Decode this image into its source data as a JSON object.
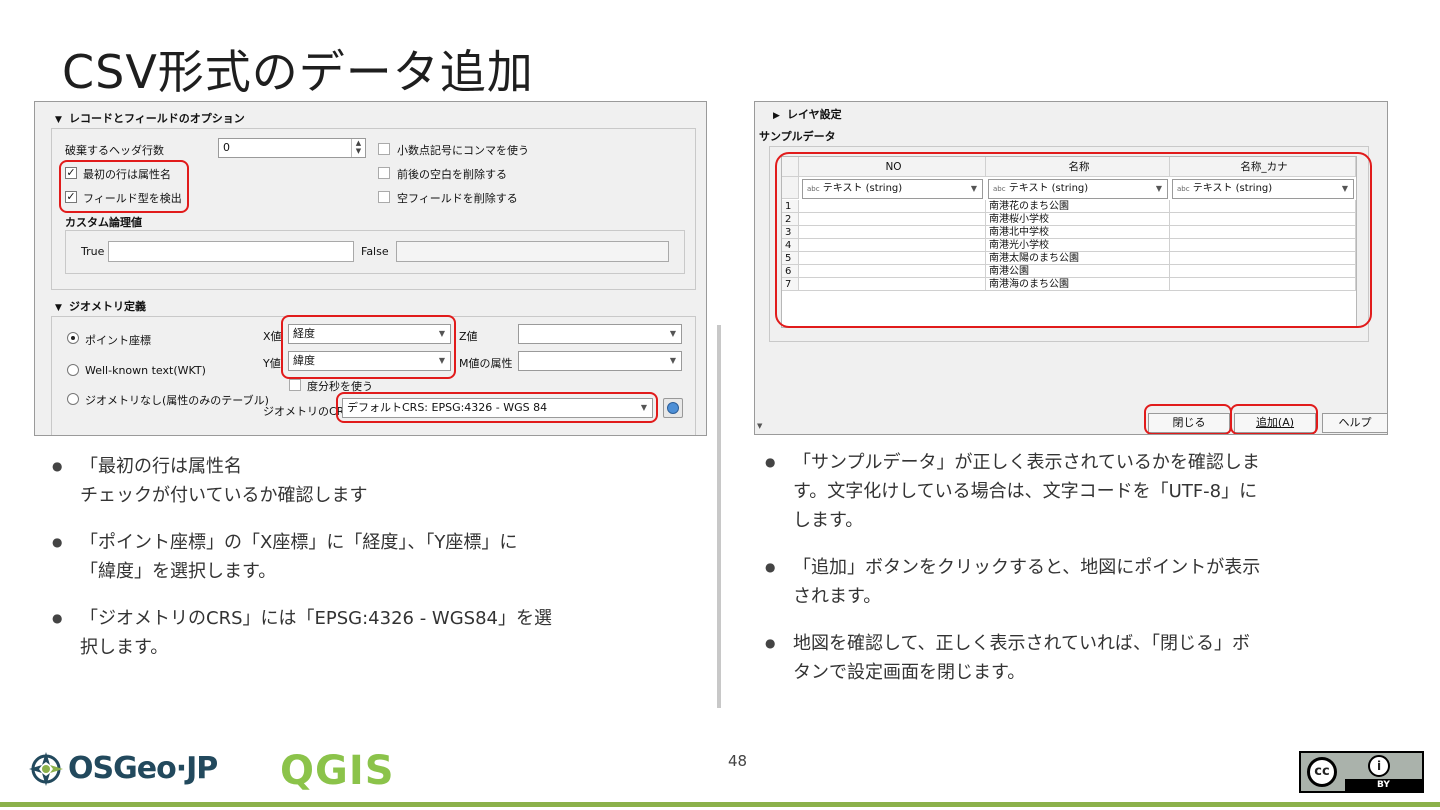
{
  "slide": {
    "title": "CSV形式のデータ追加",
    "page_number": "48"
  },
  "left_dialog": {
    "record_section_title": "レコードとフィールドのオプション",
    "discard_header_label": "破棄するヘッダ行数",
    "discard_header_value": "0",
    "first_row_names_label": "最初の行は属性名",
    "detect_types_label": "フィールド型を検出",
    "decimal_comma_label": "小数点記号にコンマを使う",
    "trim_label": "前後の空白を削除する",
    "discard_empty_label": "空フィールドを削除する",
    "custom_bool_title": "カスタム論理値",
    "true_label": "True",
    "false_label": "False",
    "geometry_section_title": "ジオメトリ定義",
    "point_coords_label": "ポイント座標",
    "wkt_label": "Well-known text(WKT)",
    "no_geometry_label": "ジオメトリなし(属性のみのテーブル)",
    "x_label": "X値",
    "x_value": "経度",
    "y_label": "Y値",
    "y_value": "緯度",
    "z_label": "Z値",
    "m_label": "M値の属性",
    "dms_label": "度分秒を使う",
    "crs_label": "ジオメトリのCRS",
    "crs_value": "デフォルトCRS: EPSG:4326 - WGS 84"
  },
  "right_dialog": {
    "layer_settings_label": "レイヤ設定",
    "sample_data_label": "サンプルデータ",
    "columns": [
      "NO",
      "名称",
      "名称_カナ"
    ],
    "column_types": [
      "テキスト (string)",
      "テキスト (string)",
      "テキスト (string)"
    ],
    "type_prefix": "abc",
    "rows": [
      {
        "num": "1",
        "name": "南港花のまち公園"
      },
      {
        "num": "2",
        "name": "南港桜小学校"
      },
      {
        "num": "3",
        "name": "南港北中学校"
      },
      {
        "num": "4",
        "name": "南港光小学校"
      },
      {
        "num": "5",
        "name": "南港太陽のまち公園"
      },
      {
        "num": "6",
        "name": "南港公園"
      },
      {
        "num": "7",
        "name": "南港海のまち公園"
      }
    ],
    "close_button": "閉じる",
    "add_button": "追加(A)",
    "help_button": "ヘルプ"
  },
  "left_bullets": [
    "「最初の行は属性名\nチェックが付いているか確認します",
    "「ポイント座標」の「X座標」に「経度」、「Y座標」に\n「緯度」を選択します。",
    "「ジオメトリのCRS」には「EPSG:4326 - WGS84」を選\n択します。"
  ],
  "right_bullets": [
    "「サンプルデータ」が正しく表示されているかを確認しま\nす。文字化けしている場合は、文字コードを「UTF-8」に\nします。",
    "「追加」ボタンをクリックすると、地図にポイントが表示\nされます。",
    "地図を確認して、正しく表示されていれば、「閉じる」ボ\nタンで設定画面を閉じます。"
  ],
  "footer": {
    "osgeo_logo_text": "OSGeo·JP",
    "qgis_logo_text": "QGIS",
    "cc_badge_text": "BY"
  },
  "colors": {
    "highlight": "#e11b1b",
    "footer_line": "#8bb14a",
    "qgis_green": "#8bc34a",
    "osgeo_blue": "#22495d"
  }
}
